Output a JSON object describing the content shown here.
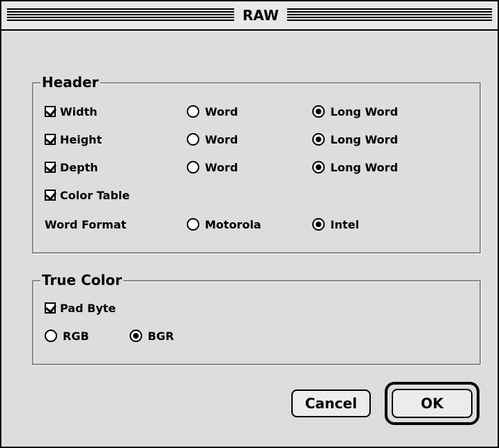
{
  "window": {
    "title": "RAW"
  },
  "header_group": {
    "title": "Header",
    "rows": [
      {
        "checkbox_label": "Width",
        "checked": true,
        "options": [
          "Word",
          "Long Word"
        ],
        "selected": "Long Word"
      },
      {
        "checkbox_label": "Height",
        "checked": true,
        "options": [
          "Word",
          "Long Word"
        ],
        "selected": "Long Word"
      },
      {
        "checkbox_label": "Depth",
        "checked": true,
        "options": [
          "Word",
          "Long Word"
        ],
        "selected": "Long Word"
      }
    ],
    "color_table": {
      "label": "Color Table",
      "checked": true
    },
    "word_format": {
      "label": "Word Format",
      "options": [
        "Motorola",
        "Intel"
      ],
      "selected": "Intel"
    }
  },
  "true_color_group": {
    "title": "True Color",
    "pad_byte": {
      "label": "Pad Byte",
      "checked": true
    },
    "order": {
      "options": [
        "RGB",
        "BGR"
      ],
      "selected": "BGR"
    }
  },
  "buttons": {
    "cancel": "Cancel",
    "ok": "OK"
  }
}
